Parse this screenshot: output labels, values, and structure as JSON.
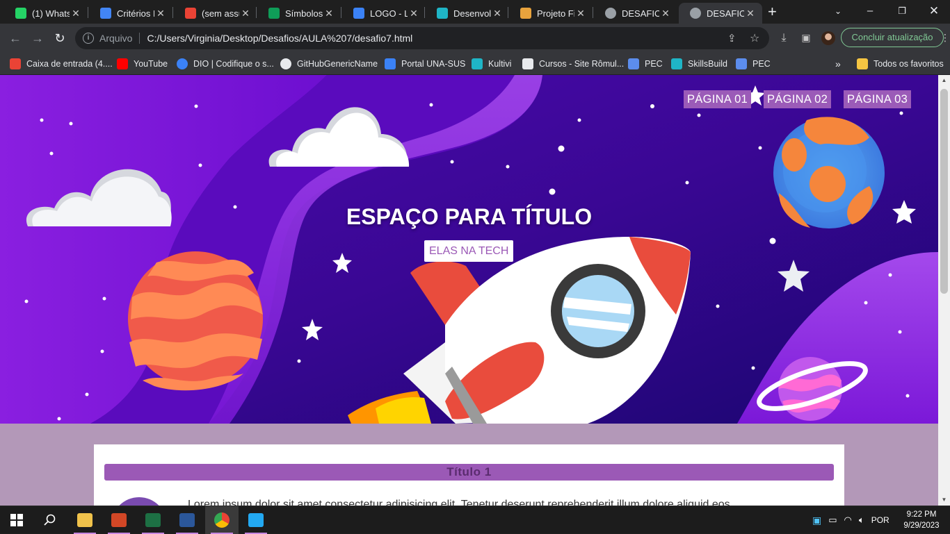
{
  "browser": {
    "tabs": [
      {
        "label": "(1) Whats",
        "color": "#25d366",
        "icon": "whatsapp-icon"
      },
      {
        "label": "Critérios P",
        "color": "#4285f4",
        "icon": "google-docs-icon"
      },
      {
        "label": "(sem assu",
        "color": "#ea4335",
        "icon": "gmail-icon"
      },
      {
        "label": "Símbolos",
        "color": "#0f9d58",
        "icon": "google-sheets-icon"
      },
      {
        "label": "LOGO - Lo",
        "color": "#3b82f6",
        "icon": "logo-site-icon"
      },
      {
        "label": "Desenvolv",
        "color": "#1fb5c6",
        "icon": "skillsbuild-icon"
      },
      {
        "label": "Projeto Fi",
        "color": "#e8a33d",
        "icon": "horse-icon"
      },
      {
        "label": "DESAFIO",
        "color": "#9aa0a6",
        "icon": "globe-icon"
      },
      {
        "label": "DESAFIO",
        "color": "#9aa0a6",
        "icon": "globe-icon",
        "active": true
      }
    ],
    "address": {
      "scheme": "Arquivo",
      "url": "C:/Users/Virginia/Desktop/Desafios/AULA%207/desafio7.html"
    },
    "update_label": "Concluir atualização",
    "bookmarks": [
      {
        "label": "Caixa de entrada (4....",
        "color": "#ea4335",
        "icon": "gmail-icon"
      },
      {
        "label": "YouTube",
        "color": "#ff0000",
        "icon": "youtube-icon"
      },
      {
        "label": "DIO | Codifique o s...",
        "color": "#3b82f6",
        "icon": "dio-icon"
      },
      {
        "label": "GitHubGenericName",
        "color": "#e8eaed",
        "icon": "github-icon"
      },
      {
        "label": "Portal UNA-SUS",
        "color": "#3b82f6",
        "icon": "una-sus-icon"
      },
      {
        "label": "Kultivi",
        "color": "#1fb5c6",
        "icon": "kultivi-icon"
      },
      {
        "label": "Cursos - Site Rômul...",
        "color": "#e8eaed",
        "icon": "course-icon"
      },
      {
        "label": "PEC",
        "color": "#5c8ded",
        "icon": "pec-icon"
      },
      {
        "label": "SkillsBuild",
        "color": "#1fb5c6",
        "icon": "skillsbuild-icon"
      },
      {
        "label": "PEC",
        "color": "#5c8ded",
        "icon": "pec-icon"
      }
    ],
    "all_bookmarks_label": "Todos os favoritos"
  },
  "page": {
    "nav": [
      "PÁGINA 01",
      "PÁGINA 02",
      "PÁGINA 03"
    ],
    "title": "ESPAÇO PARA TÍTULO",
    "subtitle": "ELAS NA TECH",
    "card_title": "Título 1",
    "card_text": "Lorem ipsum dolor sit amet consectetur adipisicing elit. Tenetur deserunt reprehenderit illum dolore aliquid eos"
  },
  "taskbar": {
    "apps": [
      {
        "name": "file-explorer-icon",
        "color": "#f0c24b",
        "running": true
      },
      {
        "name": "powerpoint-icon",
        "color": "#d24726",
        "running": true
      },
      {
        "name": "excel-icon",
        "color": "#1d7044",
        "running": true
      },
      {
        "name": "word-icon",
        "color": "#2b579a",
        "running": true
      },
      {
        "name": "chrome-icon",
        "color": "#4285f4",
        "running": true,
        "active": true
      },
      {
        "name": "vscode-icon",
        "color": "#23a9f2",
        "running": true
      }
    ],
    "language": "POR",
    "time": "9:22 PM",
    "date": "9/29/2023"
  }
}
